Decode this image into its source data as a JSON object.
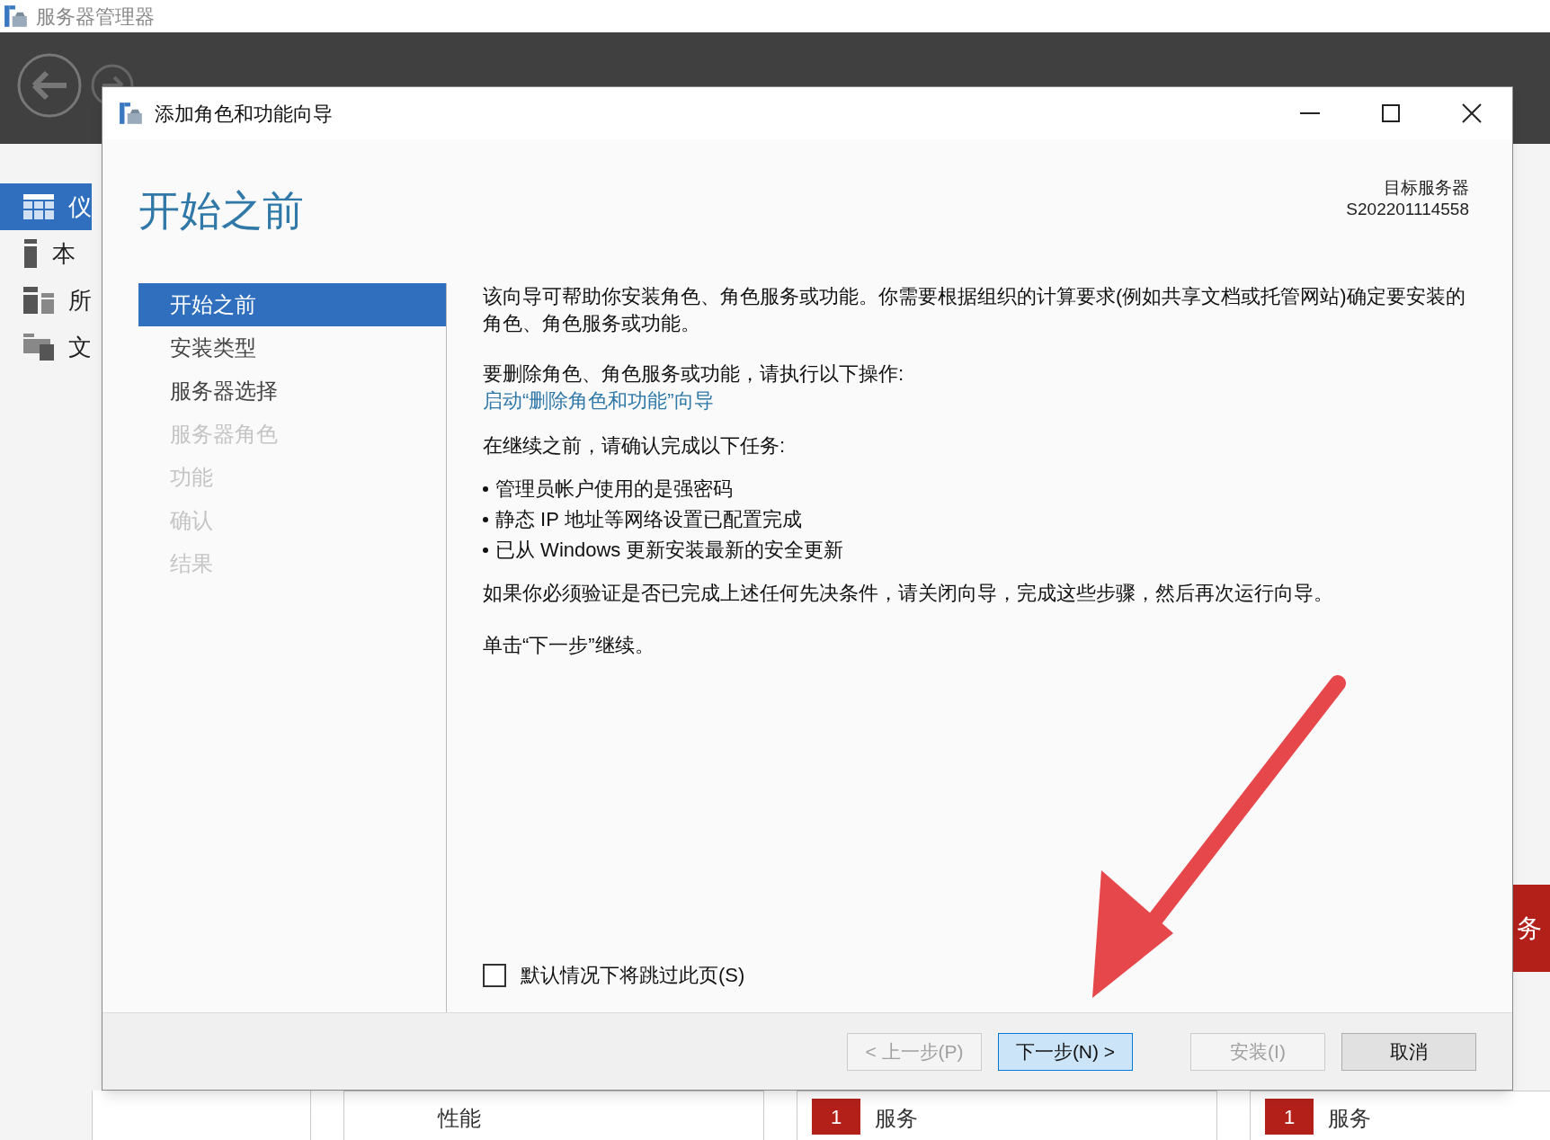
{
  "app": {
    "title": "服务器管理器"
  },
  "sidebar": {
    "items": [
      {
        "label": "仪",
        "selected": true
      },
      {
        "label": "本",
        "selected": false
      },
      {
        "label": "所",
        "selected": false
      },
      {
        "label": "文",
        "selected": false
      }
    ]
  },
  "right_tile": {
    "label": "务"
  },
  "background_tiles": [
    {
      "label": "性能"
    },
    {
      "badge": "1",
      "label": "服务"
    },
    {
      "badge": "1",
      "label": "服务"
    }
  ],
  "dialog": {
    "title": "添加角色和功能向导",
    "heading": "开始之前",
    "target_label": "目标服务器",
    "target_server": "S202201114558",
    "steps": [
      {
        "label": "开始之前",
        "selected": true,
        "disabled": false
      },
      {
        "label": "安装类型",
        "selected": false,
        "disabled": false
      },
      {
        "label": "服务器选择",
        "selected": false,
        "disabled": false
      },
      {
        "label": "服务器角色",
        "selected": false,
        "disabled": true
      },
      {
        "label": "功能",
        "selected": false,
        "disabled": true
      },
      {
        "label": "确认",
        "selected": false,
        "disabled": true
      },
      {
        "label": "结果",
        "selected": false,
        "disabled": true
      }
    ],
    "content": {
      "intro": "该向导可帮助你安装角色、角色服务或功能。你需要根据组织的计算要求(例如共享文档或托管网站)确定要安装的角色、角色服务或功能。",
      "remove_intro": "要删除角色、角色服务或功能，请执行以下操作:",
      "remove_link": "启动“删除角色和功能”向导",
      "tasks_intro": "在继续之前，请确认完成以下任务:",
      "tasks": [
        "管理员帐户使用的是强密码",
        "静态 IP 地址等网络设置已配置完成",
        "已从 Windows 更新安装最新的安全更新"
      ],
      "verify": "如果你必须验证是否已完成上述任何先决条件，请关闭向导，完成这些步骤，然后再次运行向导。",
      "continue": "单击“下一步”继续。"
    },
    "skip_checkbox": {
      "label": "默认情况下将跳过此页(S)",
      "checked": false
    },
    "buttons": [
      {
        "label": "< 上一步(P)",
        "disabled": true,
        "default": false
      },
      {
        "label": "下一步(N) >",
        "disabled": false,
        "default": true
      },
      {
        "label": "安装(I)",
        "disabled": true,
        "default": false
      },
      {
        "label": "取消",
        "disabled": false,
        "default": false
      }
    ]
  }
}
